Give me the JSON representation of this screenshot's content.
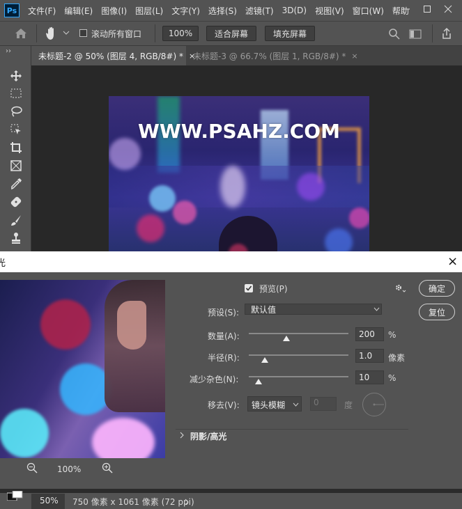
{
  "app": {
    "logo": "Ps"
  },
  "menu": [
    "文件(F)",
    "编辑(E)",
    "图像(I)",
    "图层(L)",
    "文字(Y)",
    "选择(S)",
    "滤镜(T)",
    "3D(D)",
    "视图(V)",
    "窗口(W)",
    "帮助"
  ],
  "options": {
    "scroll_all_label": "滚动所有窗口",
    "zoom_value": "100%",
    "fit_screen_label": "适合屏幕",
    "fill_screen_label": "填充屏幕"
  },
  "tabs": [
    {
      "label": "未标题-2 @ 50% (图层 4, RGB/8#) *",
      "close": "×"
    },
    {
      "label": "未标题-3 @ 66.7% (图层 1, RGB/8#) *",
      "close": "×"
    }
  ],
  "canvas": {
    "watermark": "WWW.PSAHZ.COM"
  },
  "dialog": {
    "title": "光",
    "close": "×",
    "preview_label": "预览(P)",
    "ok_label": "确定",
    "reset_label": "复位",
    "preset_label": "预设(S):",
    "preset_value": "默认值",
    "amount_label": "数量(A):",
    "amount_value": "200",
    "amount_unit": "%",
    "amount_level": 0.38,
    "radius_label": "半径(R):",
    "radius_value": "1.0",
    "radius_unit": "像素",
    "radius_level": 0.16,
    "noise_label": "减少杂色(N):",
    "noise_value": "10",
    "noise_unit": "%",
    "noise_level": 0.1,
    "remove_label": "移去(V):",
    "remove_value": "镜头模糊",
    "angle_value": "0",
    "angle_unit": "度",
    "shadow_highlight_label": "阴影/高光",
    "zoom_value": "100%"
  },
  "status": {
    "zoom": "50%",
    "doc_info": "750 像素 x 1061 像素 (72 ppi)"
  }
}
